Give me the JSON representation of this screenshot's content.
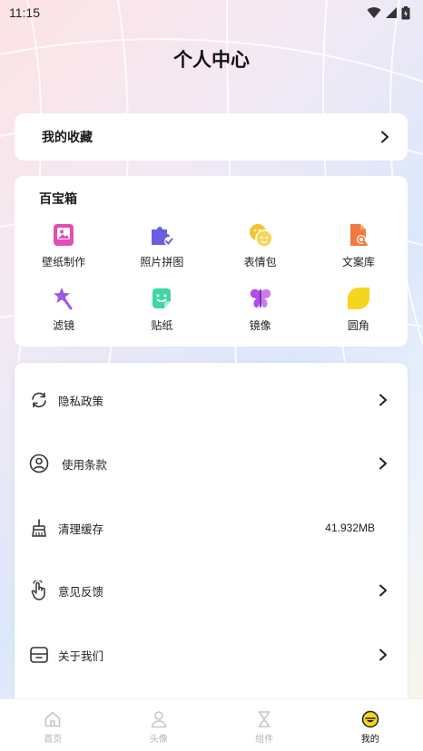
{
  "status_bar": {
    "time": "11:15"
  },
  "page_title": "个人中心",
  "favorites": {
    "label": "我的收藏"
  },
  "toolbox": {
    "title": "百宝箱",
    "items": [
      {
        "label": "壁纸制作",
        "icon": "wallpaper-icon",
        "color": "#e04fb2"
      },
      {
        "label": "照片拼图",
        "icon": "puzzle-icon",
        "color": "#6b5de0"
      },
      {
        "label": "表情包",
        "icon": "emoji-icon",
        "color": "#f4c230"
      },
      {
        "label": "文案库",
        "icon": "document-search-icon",
        "color": "#f07a3d"
      },
      {
        "label": "滤镜",
        "icon": "magic-wand-icon",
        "color": "#9b5be0"
      },
      {
        "label": "贴纸",
        "icon": "sticker-icon",
        "color": "#3ed6a4"
      },
      {
        "label": "镜像",
        "icon": "butterfly-icon",
        "color": "#b04ee6"
      },
      {
        "label": "圆角",
        "icon": "rounded-corner-icon",
        "color": "#f6d51f"
      }
    ]
  },
  "menu": [
    {
      "label": "隐私政策",
      "icon": "refresh-icon"
    },
    {
      "label": "使用条款",
      "icon": "user-circle-icon"
    },
    {
      "label": "清理缓存",
      "icon": "broom-icon",
      "value": "41.932MB"
    },
    {
      "label": "意见反馈",
      "icon": "hand-icon"
    },
    {
      "label": "关于我们",
      "icon": "box-icon"
    }
  ],
  "tabs": [
    {
      "label": "首页",
      "icon": "home-icon"
    },
    {
      "label": "头像",
      "icon": "person-icon"
    },
    {
      "label": "组件",
      "icon": "hourglass-icon"
    },
    {
      "label": "我的",
      "icon": "smiley-icon",
      "active": true
    }
  ]
}
